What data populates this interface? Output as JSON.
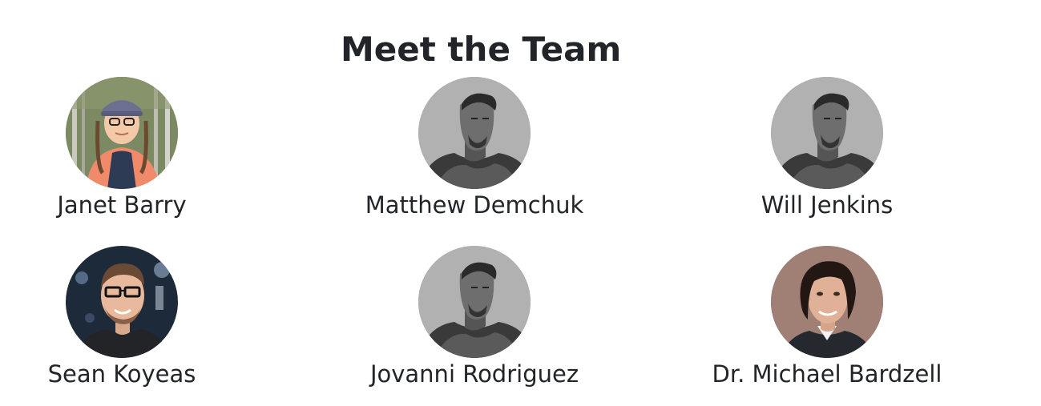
{
  "page": {
    "title": "Meet the Team"
  },
  "team": [
    {
      "name": "Janet Barry"
    },
    {
      "name": "Matthew Demchuk"
    },
    {
      "name": "Will Jenkins"
    },
    {
      "name": "Sean Koyeas"
    },
    {
      "name": "Jovanni Rodriguez"
    },
    {
      "name": "Dr. Michael Bardzell"
    }
  ],
  "colors": {
    "text": "#212529",
    "background": "#ffffff"
  }
}
